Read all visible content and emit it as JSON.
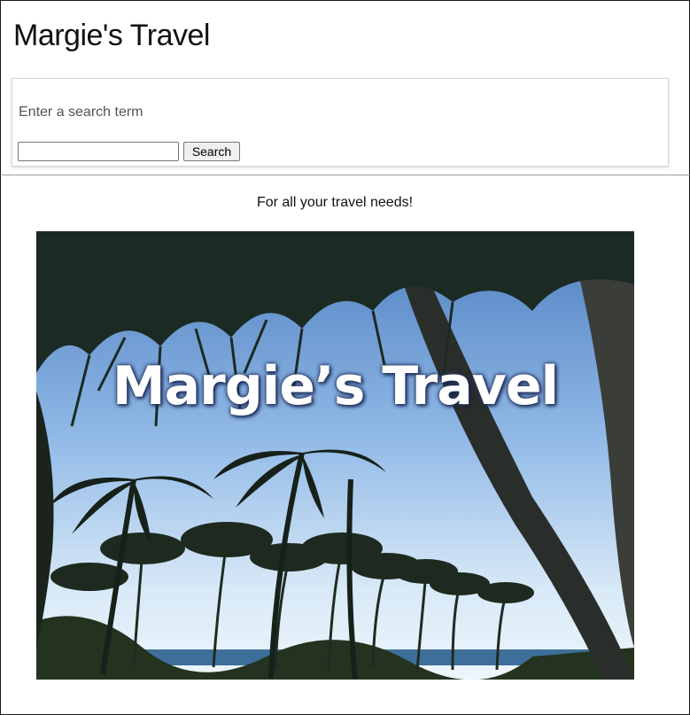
{
  "header": {
    "site_title": "Margie's Travel"
  },
  "search": {
    "prompt": "Enter a search term",
    "input_value": "",
    "button_label": "Search"
  },
  "main": {
    "tagline": "For all your travel needs!",
    "hero": {
      "overlay_text": "Margie’s Travel",
      "description": "palm trees on a tropical beach"
    }
  },
  "colors": {
    "sky_top": "#6f9fd6",
    "sky_bottom": "#cfe3f5",
    "foliage": "#1c2a22",
    "sea": "#3d6f9a"
  }
}
